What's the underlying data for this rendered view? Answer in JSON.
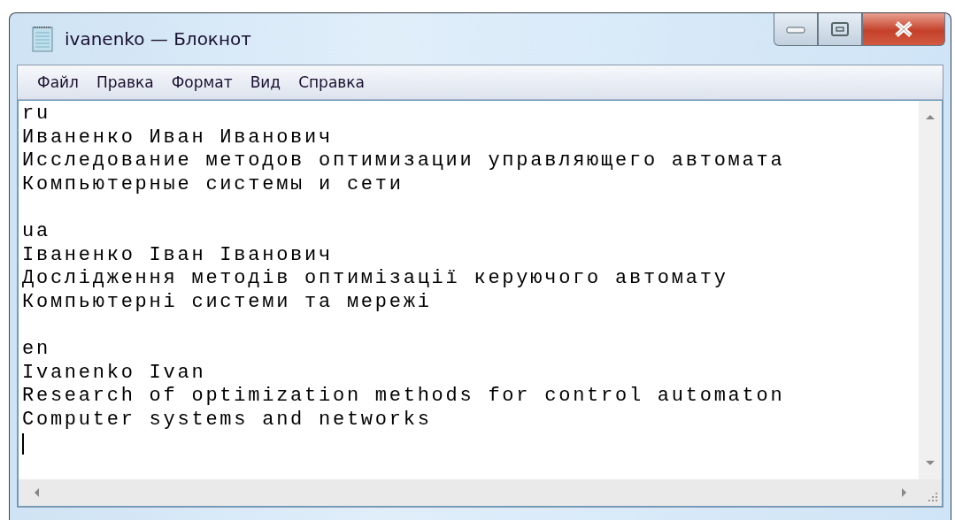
{
  "window": {
    "title": "ivanenko — Блокнот"
  },
  "menu": [
    {
      "label": "Файл"
    },
    {
      "label": "Правка"
    },
    {
      "label": "Формат"
    },
    {
      "label": "Вид"
    },
    {
      "label": "Справка"
    }
  ],
  "document": {
    "paragraphs": [
      {
        "lines": [
          "ru",
          "Иваненко Иван Иванович",
          "Исследование методов оптимизации управляющего автомата",
          "Компьютерные системы и сети"
        ]
      },
      {
        "lines": [
          "ua",
          "Іваненко Іван Іванович",
          "Дослідження методів оптимізації керуючого автомату",
          "Компьютерні системи та мережі"
        ]
      },
      {
        "lines": [
          "en",
          "Ivanenko Ivan",
          "Research of optimization methods for control automaton",
          "Computer systems and networks"
        ]
      }
    ]
  }
}
